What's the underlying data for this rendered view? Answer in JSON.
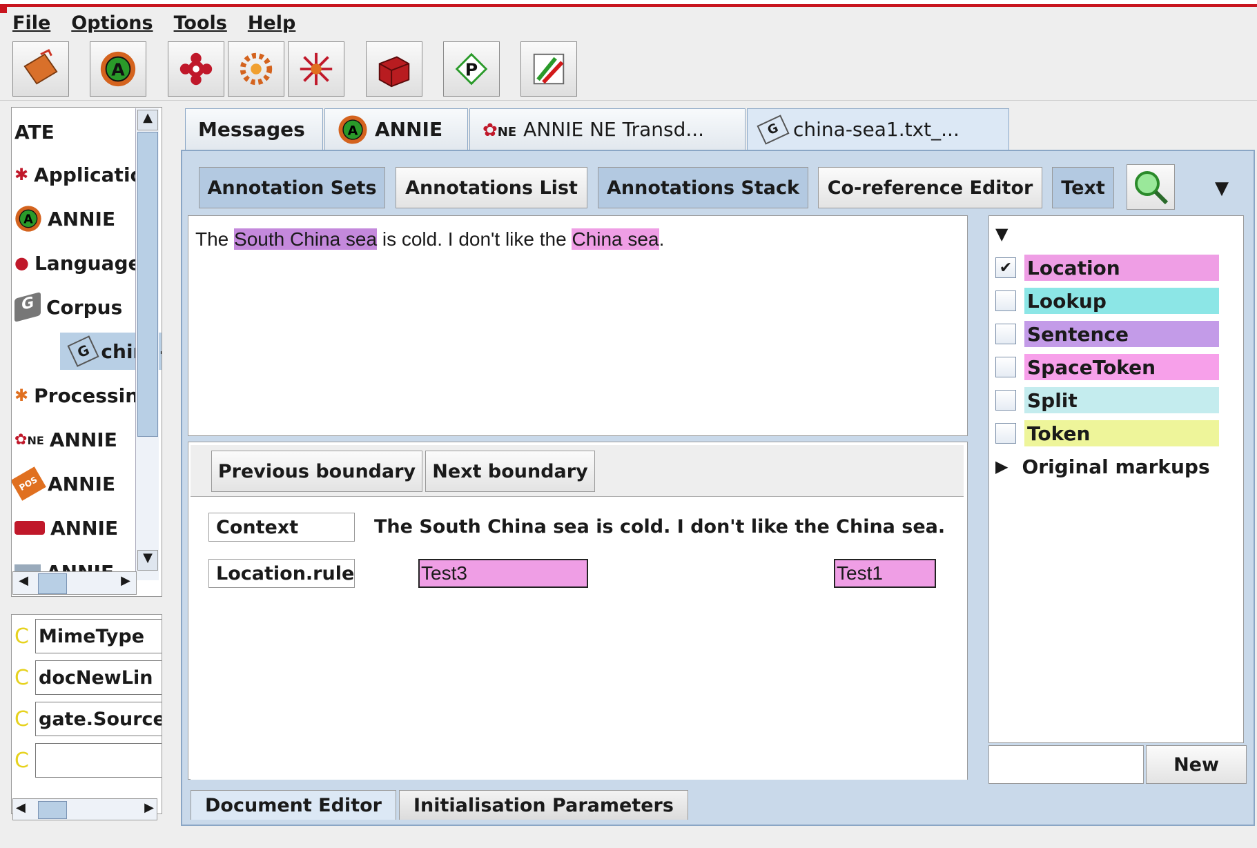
{
  "menu": [
    "File",
    "Options",
    "Tools",
    "Help"
  ],
  "toolbar_icons": [
    "restore-session-icon",
    "annie-icon",
    "language-resource-icon",
    "processing-resource-icon",
    "data-store-icon",
    "corpus-icon",
    "plugin-manager-icon",
    "export-icon"
  ],
  "left_tree": {
    "root": "ATE",
    "items": [
      {
        "label": "Applicatio",
        "icon": "applications-icon"
      },
      {
        "label": "ANNIE",
        "icon": "annie-icon"
      },
      {
        "label": "Language",
        "icon": "language-resources-icon"
      },
      {
        "label": "Corpus",
        "icon": "corpus-icon"
      },
      {
        "label": "china-",
        "icon": "document-icon",
        "selected": true
      },
      {
        "label": "Processin",
        "icon": "processing-resources-icon"
      },
      {
        "label": "ANNIE",
        "icon": "ne-transducer-icon"
      },
      {
        "label": "ANNIE",
        "icon": "pos-tagger-icon"
      },
      {
        "label": "ANNIE",
        "icon": "gazetteer-icon"
      },
      {
        "label": "ANNIE",
        "icon": "tokeniser-icon"
      }
    ]
  },
  "features": [
    {
      "marker": "C",
      "value": "MimeType"
    },
    {
      "marker": "C",
      "value": "docNewLin"
    },
    {
      "marker": "C",
      "value": "gate.Source"
    },
    {
      "marker": "C",
      "value": ""
    }
  ],
  "tabs": [
    {
      "label": "Messages"
    },
    {
      "label": "ANNIE",
      "icon": "annie-icon"
    },
    {
      "label": "ANNIE NE Transd...",
      "icon": "ne-transducer-icon"
    },
    {
      "label": "china-sea1.txt_...",
      "icon": "document-icon",
      "active": true
    }
  ],
  "view_buttons": [
    {
      "label": "Annotation Sets",
      "on": true
    },
    {
      "label": "Annotations List",
      "on": false
    },
    {
      "label": "Annotations Stack",
      "on": true
    },
    {
      "label": "Co-reference Editor",
      "on": false
    },
    {
      "label": "Text",
      "on": true
    }
  ],
  "document_text": {
    "before": "The ",
    "hl1": "South China sea",
    "mid": " is cold. I don't like the ",
    "hl2": "China sea",
    "after": "."
  },
  "stack": {
    "prev_button": "Previous boundary",
    "next_button": "Next boundary",
    "context_label": "Context",
    "context_text": "The South China sea is cold. I don't like the China sea.",
    "row_label": "Location.rule",
    "annotations": [
      "Test3",
      "Test1"
    ]
  },
  "annotation_types": [
    {
      "name": "Location",
      "checked": true,
      "color": "#ef9ee5"
    },
    {
      "name": "Lookup",
      "checked": false,
      "color": "#8ce6e6"
    },
    {
      "name": "Sentence",
      "checked": false,
      "color": "#c39be8"
    },
    {
      "name": "SpaceToken",
      "checked": false,
      "color": "#f7a0ea"
    },
    {
      "name": "Split",
      "checked": false,
      "color": "#c4ecee"
    },
    {
      "name": "Token",
      "checked": false,
      "color": "#eef59a"
    }
  ],
  "original_markups": "Original markups",
  "new_set_button": "New",
  "bottom_tabs": [
    "Document Editor",
    "Initialisation Parameters"
  ]
}
